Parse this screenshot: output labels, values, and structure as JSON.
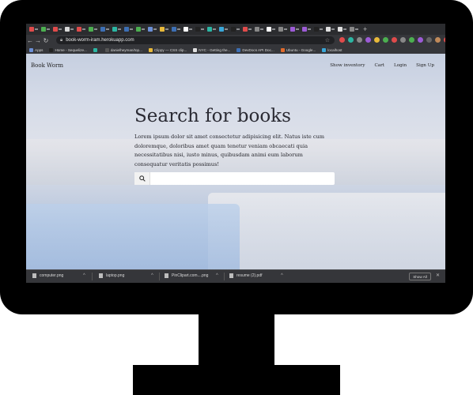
{
  "browser": {
    "url": "book-worm-iram.herokuapp.com",
    "bookmarks": [
      {
        "label": "Apps",
        "color": "#6b8fd6"
      },
      {
        "label": "Home - Sequelize...",
        "color": "#222222"
      },
      {
        "label": "",
        "color": "#2bb6a3"
      },
      {
        "label": "danielheyman/top...",
        "color": "#555555"
      },
      {
        "label": "Clippy — CSS clip...",
        "color": "#e8b93a"
      },
      {
        "label": "NYC - Getting the...",
        "color": "#e0e0e0"
      },
      {
        "label": "DevDocs API Doc...",
        "color": "#3d6fb4"
      },
      {
        "label": "Ubuntu - Google...",
        "color": "#e06a2c"
      },
      {
        "label": "localhost",
        "color": "#3aa7d9"
      }
    ]
  },
  "site": {
    "brand": "Book Worm",
    "nav": [
      "Show inventory",
      "Cart",
      "Login",
      "Sign Up"
    ],
    "hero_title": "Search for books",
    "hero_text": "Lorem ipsum dolor sit amet consectetur adipisicing elit. Natus iste cum doloremque, doloribus amet quam tenetur veniam obcaecati quia necessitatibus nisi, iusto minus, quibusdam animi eum laborum consequatur veritatis possimus!",
    "search_placeholder": ""
  },
  "downloads": {
    "files": [
      "computer.png",
      "laptop.png",
      "PinClipart.com....png",
      "resume (2).pdf"
    ],
    "show_all": "Show All"
  },
  "colors": {
    "bezel": "#000000",
    "browser_chrome": "#35363a",
    "page_title": "#2a2a33"
  }
}
